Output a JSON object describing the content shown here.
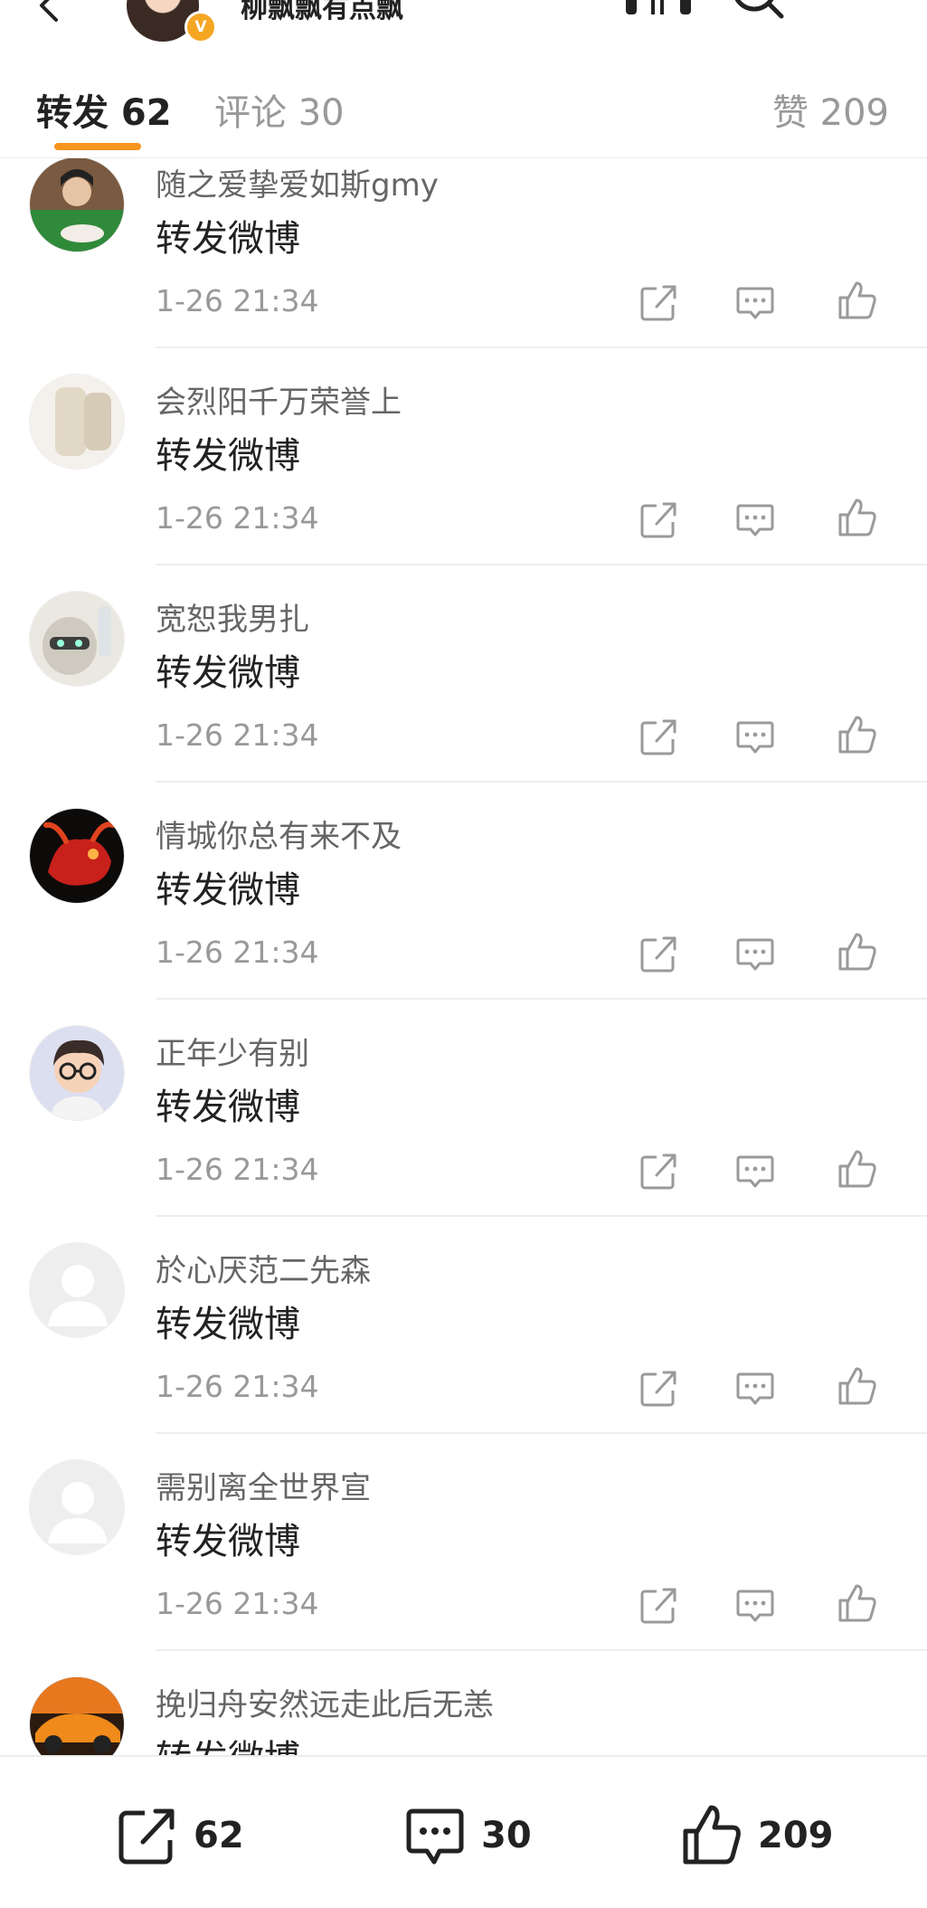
{
  "header": {
    "name": "柳飘飘有点飘",
    "verified_mark": "V"
  },
  "tabs": {
    "repost": "转发 62",
    "comment": "评论 30",
    "like": "赞 209"
  },
  "reposts": [
    {
      "user": "随之爱挚爱如斯gmy",
      "text": "转发微博",
      "time": "1-26 21:34"
    },
    {
      "user": "会烈阳千万荣誉上",
      "text": "转发微博",
      "time": "1-26 21:34"
    },
    {
      "user": "宽恕我男扎",
      "text": "转发微博",
      "time": "1-26 21:34"
    },
    {
      "user": "情城你总有来不及",
      "text": "转发微博",
      "time": "1-26 21:34"
    },
    {
      "user": "正年少有别",
      "text": "转发微博",
      "time": "1-26 21:34"
    },
    {
      "user": "於心厌范二先森",
      "text": "转发微博",
      "time": "1-26 21:34"
    },
    {
      "user": "需别离全世界宣",
      "text": "转发微博",
      "time": "1-26 21:34"
    },
    {
      "user": "挽归舟安然远走此后无恙",
      "text": "转发微博",
      "time": ""
    }
  ],
  "bottom_bar": {
    "repost_count": "62",
    "comment_count": "30",
    "like_count": "209"
  },
  "colors": {
    "accent": "#f7941d",
    "badge": "#f5a623",
    "muted_text": "#999999",
    "icon_gray": "#9a9a9a"
  }
}
